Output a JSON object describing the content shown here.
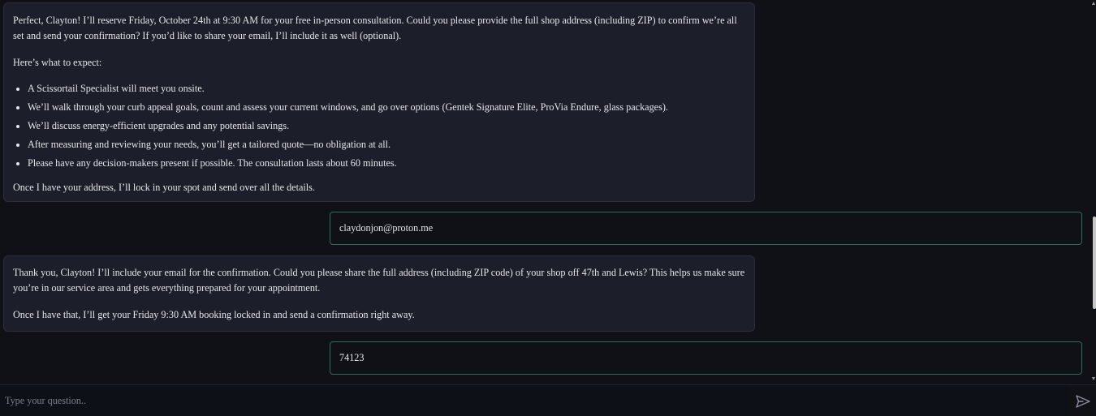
{
  "messages": {
    "bot_1": {
      "intro": "Perfect, Clayton! I’ll reserve Friday, October 24th at 9:30 AM for your free in-person consultation. Could you please provide the full shop address (including ZIP) to confirm we’re all set and send your confirmation? If you’d like to share your email, I’ll include it as well (optional).",
      "expect_heading": "Here’s what to expect:",
      "bullets": [
        "A Scissortail Specialist will meet you onsite.",
        "We’ll walk through your curb appeal goals, count and assess your current windows, and go over options (Gentek Signature Elite, ProVia Endure, glass packages).",
        "We’ll discuss energy-efficient upgrades and any potential savings.",
        "After measuring and reviewing your needs, you’ll get a tailored quote—no obligation at all.",
        "Please have any decision-makers present if possible. The consultation lasts about 60 minutes."
      ],
      "closing": "Once I have your address, I’ll lock in your spot and send over all the details."
    },
    "user_1": "claydonjon@proton.me",
    "bot_2": {
      "body": "Thank you, Clayton! I’ll include your email for the confirmation. Could you please share the full address (including ZIP code) of your shop off 47th and Lewis? This helps us make sure you’re in our service area and gets everything prepared for your appointment.",
      "closing": "Once I have that, I’ll get your Friday 9:30 AM booking locked in and send a confirmation right away."
    },
    "user_2": "74123"
  },
  "composer": {
    "placeholder": "Type your question..",
    "send_icon": "send-icon"
  },
  "colors": {
    "background": "#0f1117",
    "bot_bubble": "#1c1f29",
    "user_border": "#2f6b58",
    "text": "#e4e6eb",
    "placeholder": "#7a7f8c"
  }
}
